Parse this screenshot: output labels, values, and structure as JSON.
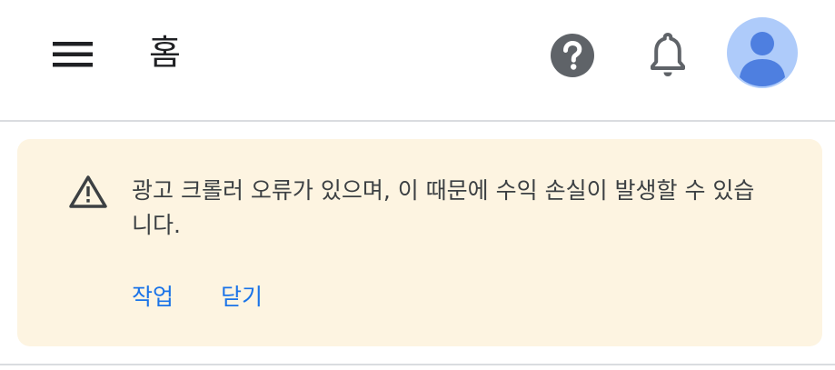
{
  "header": {
    "menu_icon": "hamburger-menu-icon",
    "title": "홈",
    "help_icon": "help-circle-icon",
    "notifications_icon": "bell-icon",
    "account_icon": "account-avatar-icon"
  },
  "alert": {
    "icon": "warning-triangle-icon",
    "message": "광고 크롤러 오류가 있으며, 이 때문에 수익 손실이 발생할 수 있습니다.",
    "actions": {
      "primary_label": "작업",
      "dismiss_label": "닫기"
    }
  },
  "colors": {
    "alert_background": "#fdf4e1",
    "action_text": "#1a73e8",
    "avatar_background": "#aecbfa",
    "avatar_figure": "#4e7fe0",
    "icon_dark": "#5f6368",
    "divider": "#dadce0"
  }
}
